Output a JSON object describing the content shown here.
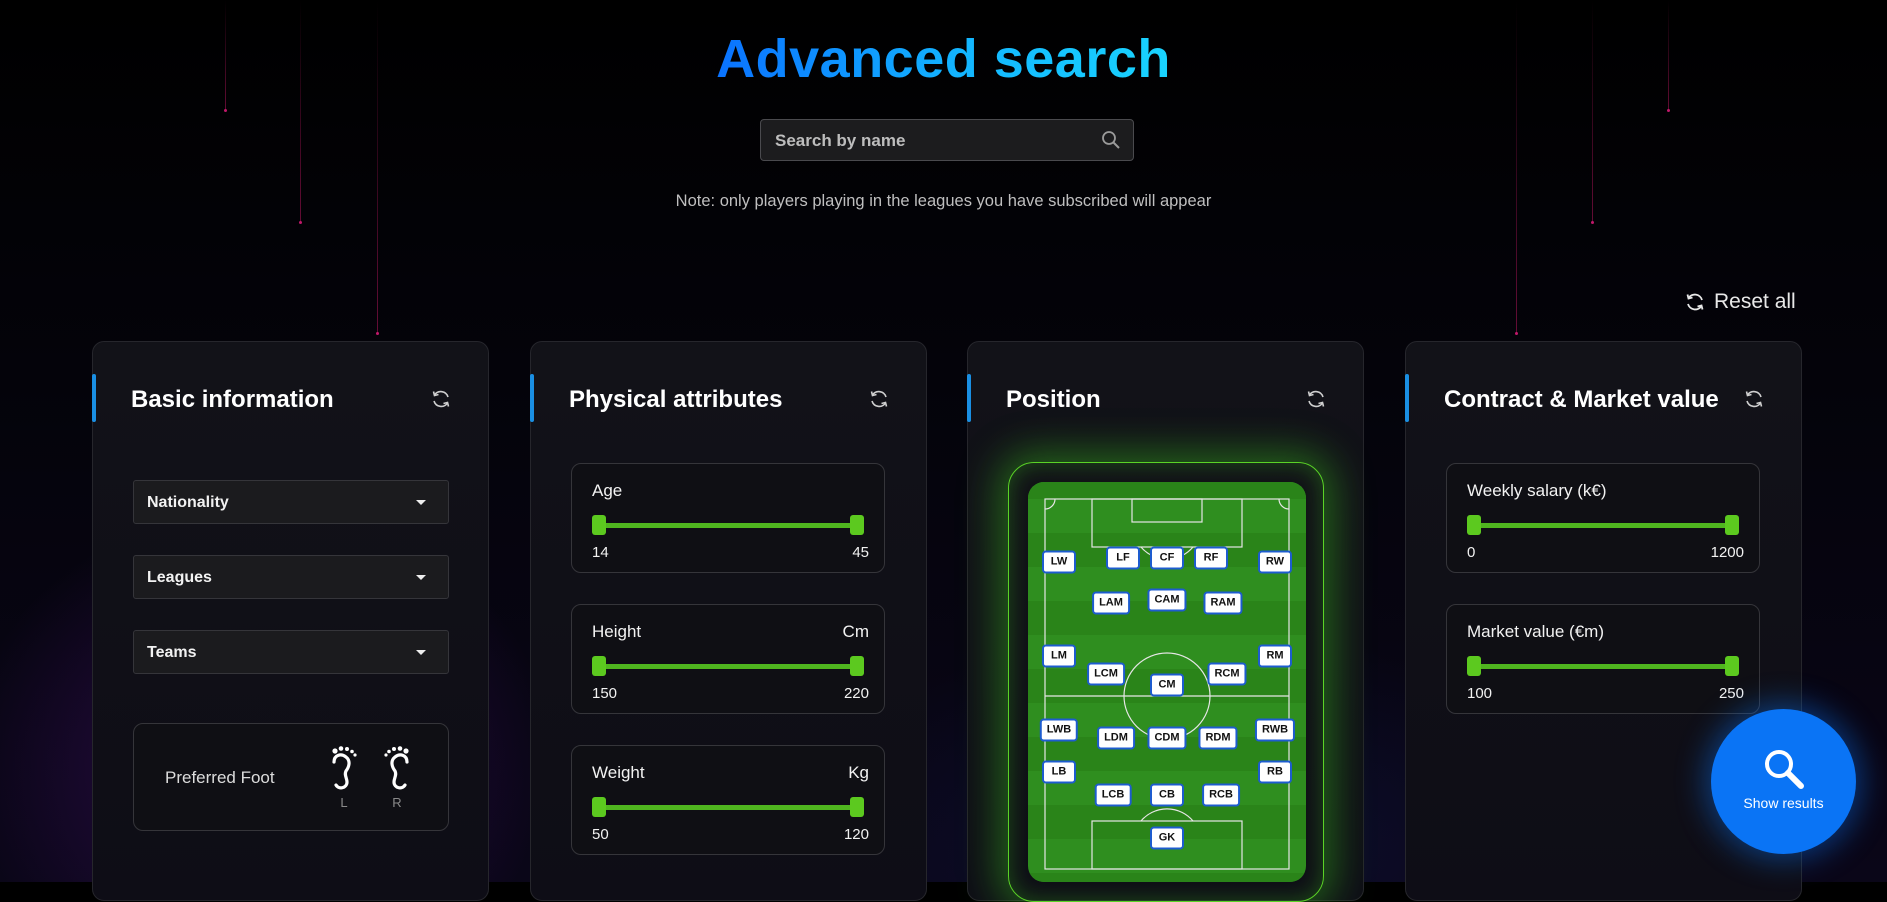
{
  "page": {
    "title": "Advanced search",
    "note": "Note: only players playing in the leagues you have subscribed will appear",
    "reset_all_label": "Reset all"
  },
  "search": {
    "placeholder": "Search by name",
    "value": ""
  },
  "colors": {
    "title_gradient": [
      "#0a72ff",
      "#19d4ff"
    ],
    "card_accent": "#1a8fe3",
    "slider_green": "#5cc91f",
    "pitch_green": "#2f8e1f",
    "position_border": "#1d5ccf",
    "show_results_blue": "#0a74f5"
  },
  "basic_information": {
    "title": "Basic information",
    "dropdowns": [
      {
        "label": "Nationality"
      },
      {
        "label": "Leagues"
      },
      {
        "label": "Teams"
      }
    ],
    "preferred_foot": {
      "label": "Preferred Foot",
      "left": "L",
      "right": "R"
    }
  },
  "physical_attributes": {
    "title": "Physical attributes",
    "sliders": [
      {
        "label": "Age",
        "unit": "",
        "min": "14",
        "max": "45"
      },
      {
        "label": "Height",
        "unit": "Cm",
        "min": "150",
        "max": "220"
      },
      {
        "label": "Weight",
        "unit": "Kg",
        "min": "50",
        "max": "120"
      }
    ]
  },
  "position": {
    "title": "Position",
    "positions": [
      "LW",
      "LF",
      "CF",
      "RF",
      "RW",
      "LAM",
      "CAM",
      "RAM",
      "LM",
      "LCM",
      "CM",
      "RCM",
      "RM",
      "LWB",
      "LDM",
      "CDM",
      "RDM",
      "RWB",
      "LB",
      "LCB",
      "CB",
      "RCB",
      "RB",
      "GK"
    ]
  },
  "contract_market": {
    "title": "Contract & Market value",
    "sliders": [
      {
        "label": "Weekly salary (k€)",
        "min": "0",
        "max": "1200"
      },
      {
        "label": "Market value (€m)",
        "min": "100",
        "max": "250"
      }
    ]
  },
  "show_results": {
    "label": "Show results"
  }
}
